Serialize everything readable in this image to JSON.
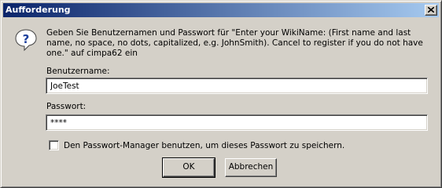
{
  "window": {
    "title": "Aufforderung",
    "titlebar_color_start": "#0a246a",
    "titlebar_color_end": "#a6caf0",
    "background_color": "#d4d0c8"
  },
  "icons": {
    "dialog": "question-icon",
    "close": "close-icon"
  },
  "message": "Geben Sie Benutzernamen und Passwort für \"Enter your WikiName: (First name and last name, no space, no dots, capitalized, e.g. JohnSmith). Cancel to register if you do not have one.\" auf cimpa62 ein",
  "username": {
    "label": "Benutzername:",
    "value": "JoeTest"
  },
  "password": {
    "label": "Passwort:",
    "value": "****"
  },
  "checkbox": {
    "label": "Den Passwort-Manager benutzen, um dieses Passwort zu speichern.",
    "checked": false
  },
  "buttons": {
    "ok": "OK",
    "cancel": "Abbrechen"
  }
}
